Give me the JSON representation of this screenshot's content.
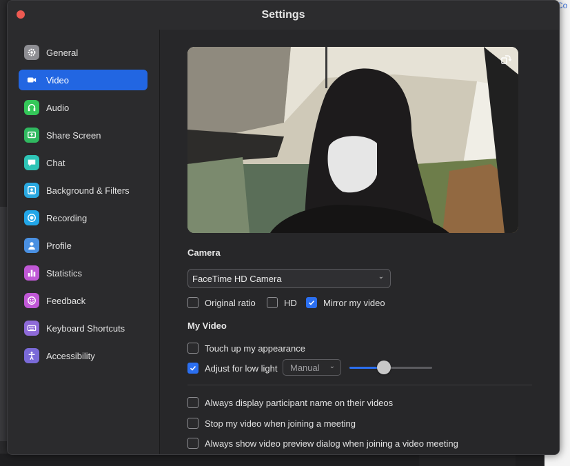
{
  "background": {
    "right_link": "Co"
  },
  "window": {
    "title": "Settings"
  },
  "sidebar": {
    "items": [
      {
        "label": "General",
        "icon": "gear-icon",
        "color": "#8e8e93",
        "active": false
      },
      {
        "label": "Video",
        "icon": "video-camera-icon",
        "color": "#2266e2",
        "active": true
      },
      {
        "label": "Audio",
        "icon": "headphones-icon",
        "color": "#34c759",
        "active": false
      },
      {
        "label": "Share Screen",
        "icon": "share-screen-icon",
        "color": "#30b960",
        "active": false
      },
      {
        "label": "Chat",
        "icon": "chat-bubble-icon",
        "color": "#2ec4b6",
        "active": false
      },
      {
        "label": "Background & Filters",
        "icon": "background-person-icon",
        "color": "#2aa8e0",
        "active": false
      },
      {
        "label": "Recording",
        "icon": "record-icon",
        "color": "#22a6e8",
        "active": false
      },
      {
        "label": "Profile",
        "icon": "person-icon",
        "color": "#4a90e2",
        "active": false
      },
      {
        "label": "Statistics",
        "icon": "bar-chart-icon",
        "color": "#c058d6",
        "active": false
      },
      {
        "label": "Feedback",
        "icon": "smiley-icon",
        "color": "#c058d6",
        "active": false
      },
      {
        "label": "Keyboard Shortcuts",
        "icon": "keyboard-icon",
        "color": "#8e6ad8",
        "active": false
      },
      {
        "label": "Accessibility",
        "icon": "accessibility-icon",
        "color": "#7a6ad8",
        "active": false
      }
    ]
  },
  "camera": {
    "section_label": "Camera",
    "selected": "FaceTime HD Camera",
    "options": [
      {
        "label": "Original ratio",
        "checked": false
      },
      {
        "label": "HD",
        "checked": false
      },
      {
        "label": "Mirror my video",
        "checked": true
      }
    ]
  },
  "my_video": {
    "section_label": "My Video",
    "touch_up": {
      "label": "Touch up my appearance",
      "checked": false
    },
    "low_light": {
      "label": "Adjust for low light",
      "checked": true,
      "mode": "Manual",
      "level": 0.42
    }
  },
  "general_options": [
    {
      "label": "Always display participant name on their videos",
      "checked": false
    },
    {
      "label": "Stop my video when joining a meeting",
      "checked": false
    },
    {
      "label": "Always show video preview dialog when joining a video meeting",
      "checked": false
    }
  ],
  "colors": {
    "accent": "#2266e2",
    "close": "#ee5a52"
  }
}
